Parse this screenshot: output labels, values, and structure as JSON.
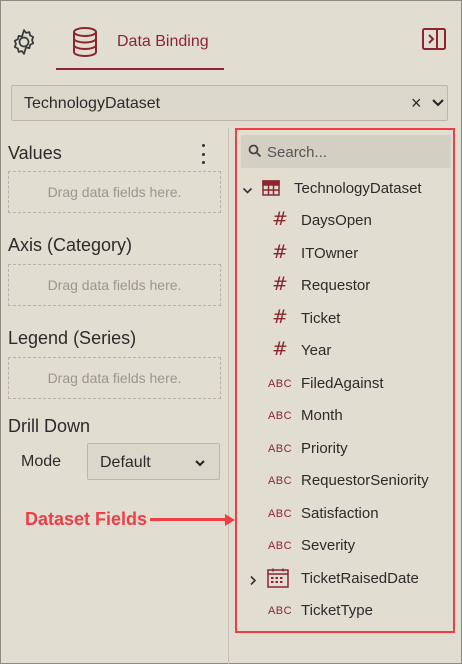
{
  "header": {
    "tab_label": "Data Binding",
    "icons": [
      "gear-icon",
      "database-icon",
      "panel-toggle-icon"
    ]
  },
  "dataset": {
    "selected": "TechnologyDataset",
    "clear_glyph": "×"
  },
  "sections": {
    "values_title": "Values",
    "axis_title": "Axis (Category)",
    "legend_title": "Legend (Series)",
    "drill_title": "Drill Down",
    "dropzone_text": "Drag data fields here."
  },
  "drill": {
    "mode_label": "Mode",
    "mode_value": "Default"
  },
  "annotation": {
    "label": "Dataset Fields",
    "color": "#ef3e46"
  },
  "fields_panel": {
    "search_placeholder": "Search...",
    "root": "TechnologyDataset",
    "num_glyph": "#",
    "str_glyph": "ABC",
    "fields": [
      {
        "name": "DaysOpen",
        "type": "number"
      },
      {
        "name": "ITOwner",
        "type": "number"
      },
      {
        "name": "Requestor",
        "type": "number"
      },
      {
        "name": "Ticket",
        "type": "number"
      },
      {
        "name": "Year",
        "type": "number"
      },
      {
        "name": "FiledAgainst",
        "type": "string"
      },
      {
        "name": "Month",
        "type": "string"
      },
      {
        "name": "Priority",
        "type": "string"
      },
      {
        "name": "RequestorSeniority",
        "type": "string"
      },
      {
        "name": "Satisfaction",
        "type": "string"
      },
      {
        "name": "Severity",
        "type": "string"
      },
      {
        "name": "TicketRaisedDate",
        "type": "date"
      },
      {
        "name": "TicketType",
        "type": "string"
      }
    ]
  },
  "colors": {
    "accent": "#8b2631",
    "background": "#e2ddd1"
  }
}
